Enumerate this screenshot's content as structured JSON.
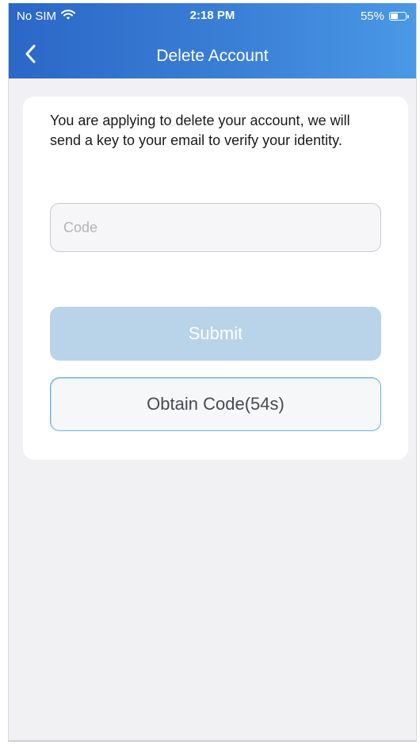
{
  "status_bar": {
    "carrier": "No SIM",
    "time": "2:18 PM",
    "battery_percent": "55%",
    "battery_level": 0.55,
    "wifi_icon": "wifi-icon"
  },
  "nav": {
    "title": "Delete Account",
    "back_icon": "chevron-left-icon"
  },
  "form": {
    "intro_text": "You are applying to delete your account, we will send a key to your email to verify your identity.",
    "code_placeholder": "Code",
    "code_value": "",
    "submit_label": "Submit",
    "obtain_code_label": "Obtain Code(54s)"
  },
  "colors": {
    "header_start": "#2b67c7",
    "header_end": "#4a98e6",
    "submit_disabled": "#b9d3e9",
    "obtain_border": "#5fb4d8",
    "page_background": "#f1f1f4"
  }
}
